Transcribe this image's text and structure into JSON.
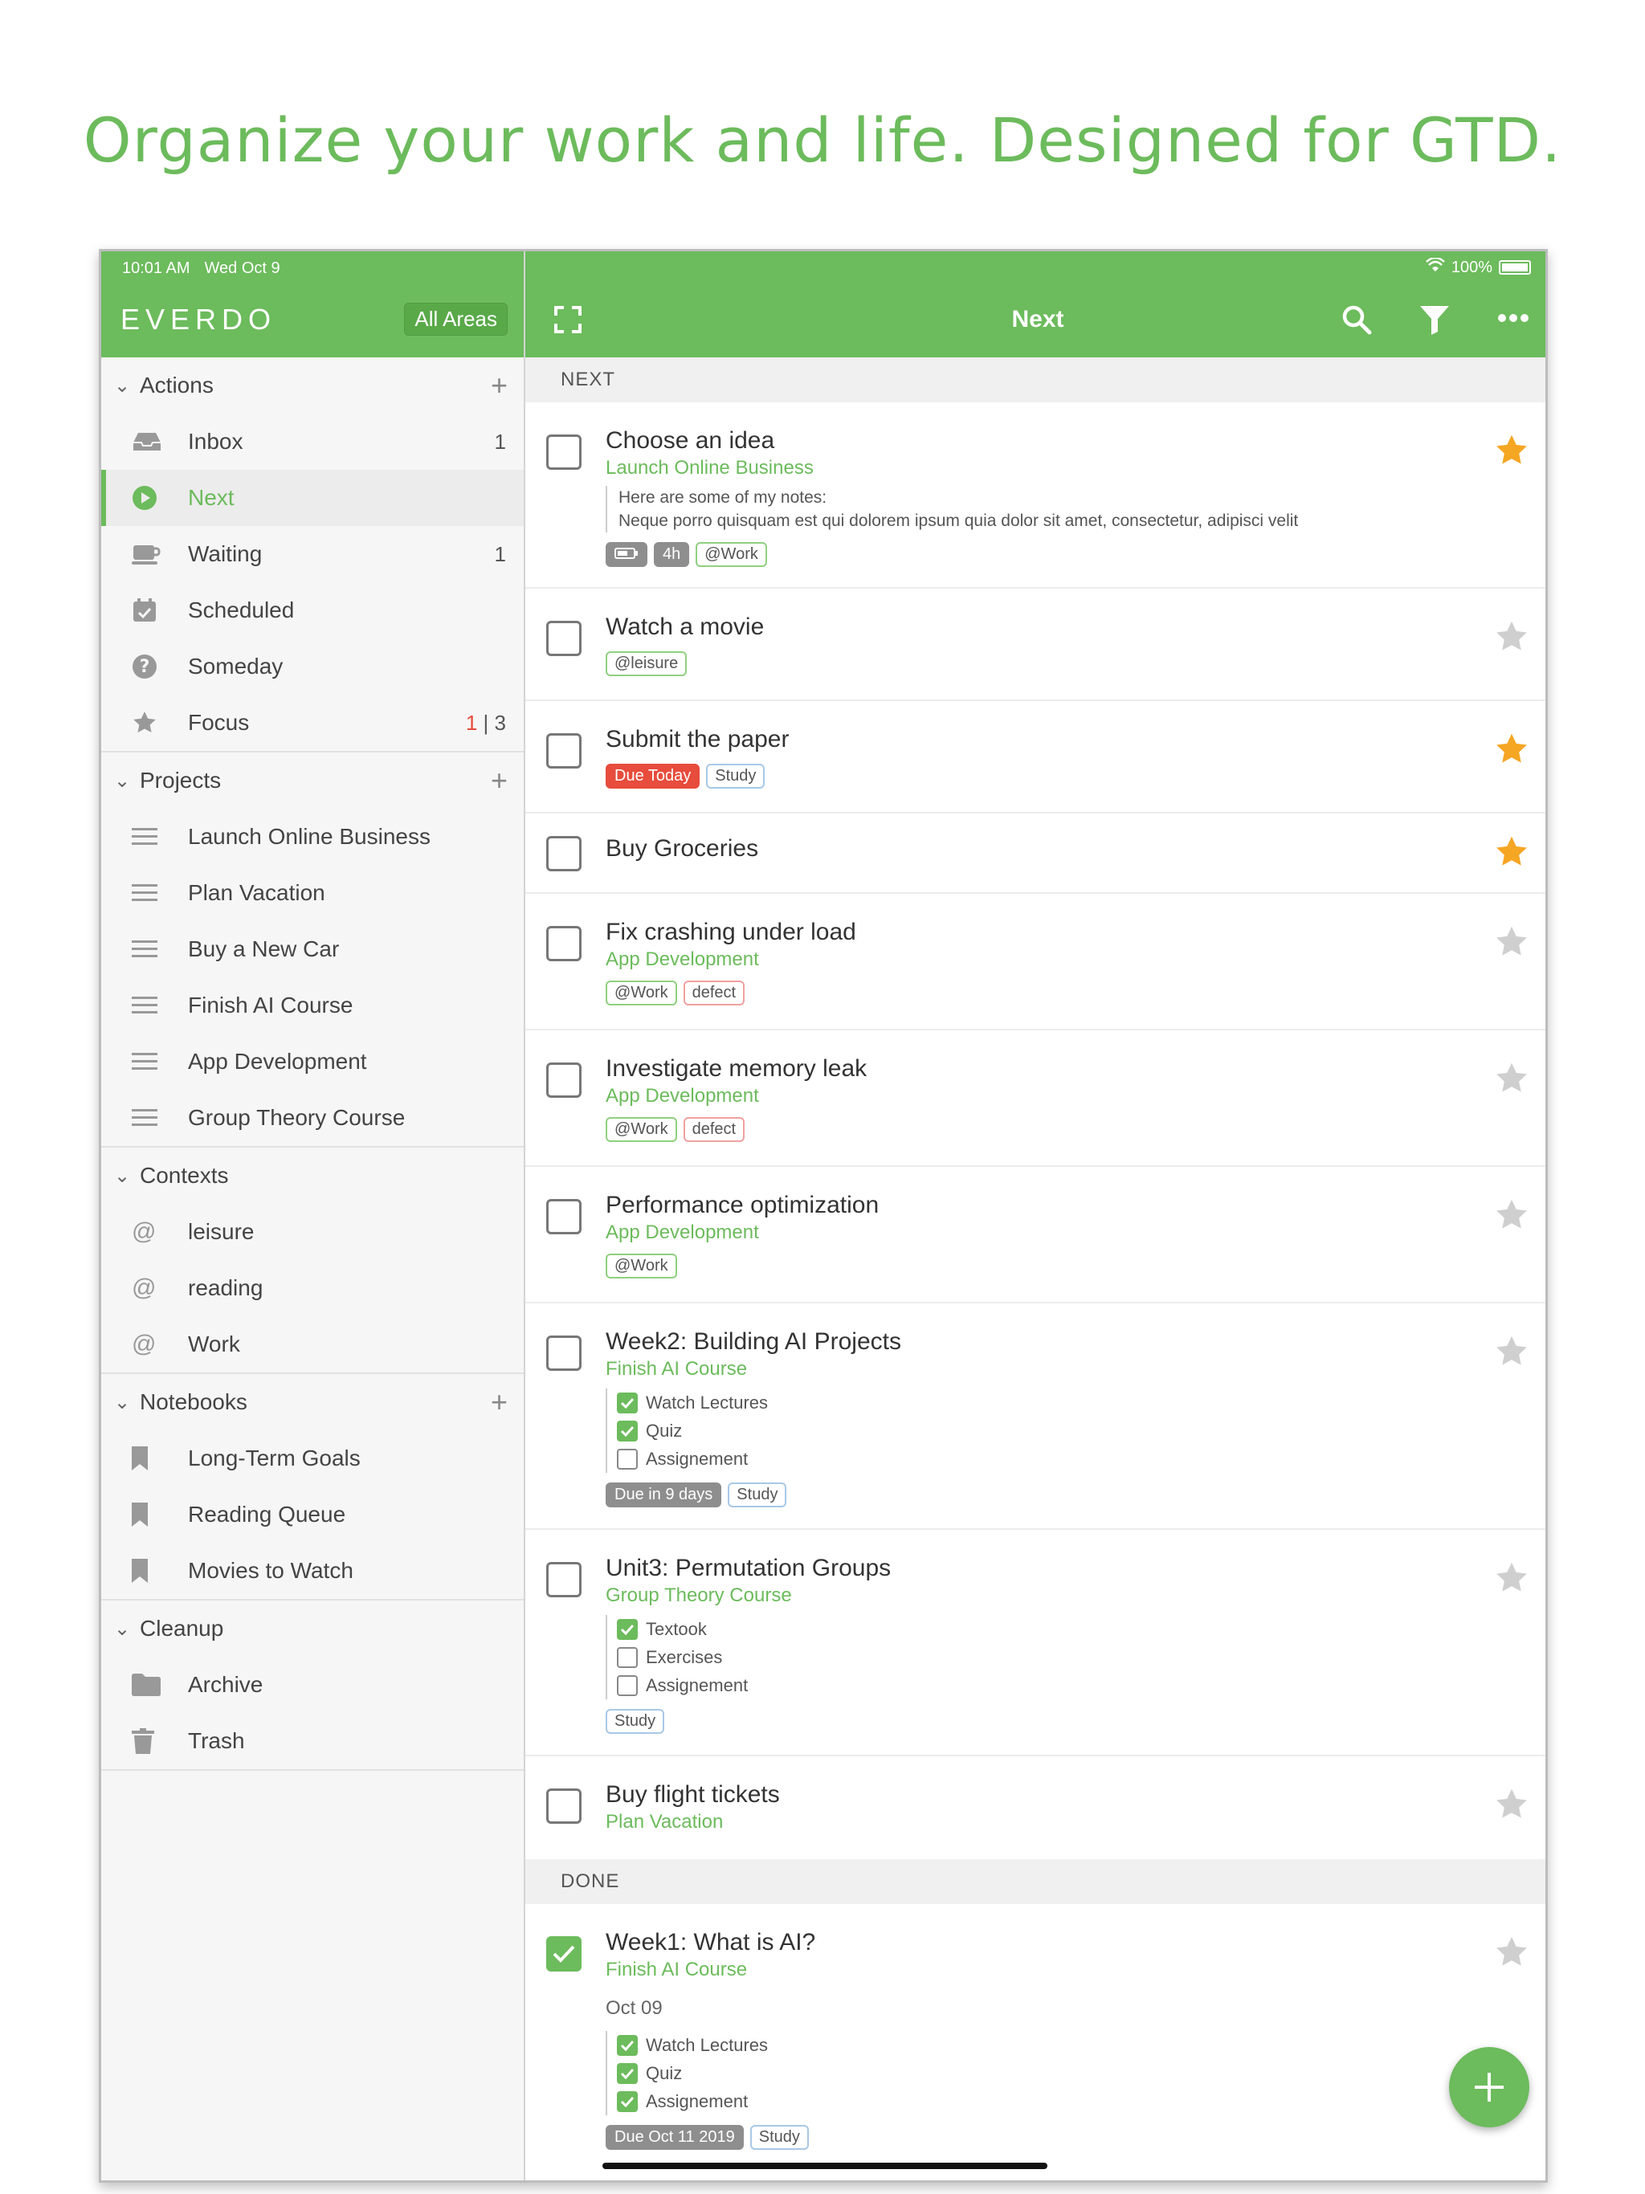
{
  "headline": "Organize your work and life. Designed for GTD.",
  "status": {
    "time": "10:01 AM",
    "date": "Wed Oct 9",
    "battery": "100%"
  },
  "sidebar": {
    "brand": "EVERDO",
    "areas_button": "All Areas",
    "sections": [
      {
        "title": "Actions",
        "items": [
          {
            "label": "Inbox",
            "icon": "inbox-icon",
            "count": "1"
          },
          {
            "label": "Next",
            "icon": "play-circle-icon",
            "count": "",
            "active": true
          },
          {
            "label": "Waiting",
            "icon": "coffee-cup-icon",
            "count": "1"
          },
          {
            "label": "Scheduled",
            "icon": "calendar-check-icon",
            "count": ""
          },
          {
            "label": "Someday",
            "icon": "question-circle-icon",
            "count": ""
          },
          {
            "label": "Focus",
            "icon": "star-icon",
            "count_red": "1",
            "count_sep": "|",
            "count_rest": "3"
          }
        ]
      },
      {
        "title": "Projects",
        "items": [
          {
            "label": "Launch Online Business"
          },
          {
            "label": "Plan Vacation"
          },
          {
            "label": "Buy a New Car"
          },
          {
            "label": "Finish AI Course"
          },
          {
            "label": "App Development"
          },
          {
            "label": "Group Theory Course"
          }
        ]
      },
      {
        "title": "Contexts",
        "items": [
          {
            "label": "leisure"
          },
          {
            "label": "reading"
          },
          {
            "label": "Work"
          }
        ]
      },
      {
        "title": "Notebooks",
        "items": [
          {
            "label": "Long-Term Goals"
          },
          {
            "label": "Reading Queue"
          },
          {
            "label": "Movies to Watch"
          }
        ]
      },
      {
        "title": "Cleanup",
        "items": [
          {
            "label": "Archive"
          },
          {
            "label": "Trash"
          }
        ]
      }
    ]
  },
  "main": {
    "title": "Next",
    "section_next": "NEXT",
    "section_done": "DONE",
    "tasks": [
      {
        "title": "Choose an idea",
        "project": "Launch Online Business",
        "note_1": "Here are some of my notes:",
        "note_2": "Neque porro quisquam est qui dolorem ipsum quia dolor sit amet, consectetur, adipisci velit",
        "tag_time": "4h",
        "tag_ctx": "@Work"
      },
      {
        "title": "Watch a movie",
        "tag_ctx": "@leisure"
      },
      {
        "title": "Submit the paper",
        "tag_due": "Due Today",
        "tag_study": "Study"
      },
      {
        "title": "Buy Groceries"
      },
      {
        "title": "Fix crashing under load",
        "project": "App Development",
        "tag_ctx": "@Work",
        "tag_def": "defect"
      },
      {
        "title": "Investigate memory leak",
        "project": "App Development",
        "tag_ctx": "@Work",
        "tag_def": "defect"
      },
      {
        "title": "Performance optimization",
        "project": "App Development",
        "tag_ctx": "@Work"
      },
      {
        "title": "Week2: Building AI Projects",
        "project": "Finish AI Course",
        "checklist": [
          "Watch Lectures",
          "Quiz",
          "Assignement"
        ],
        "tag_due": "Due in 9 days",
        "tag_study": "Study"
      },
      {
        "title": "Unit3: Permutation Groups",
        "project": "Group Theory Course",
        "checklist": [
          "Textook",
          "Exercises",
          "Assignement"
        ],
        "tag_study": "Study"
      },
      {
        "title": "Buy flight tickets",
        "project": "Plan Vacation"
      },
      {
        "title": "Week1: What is AI?",
        "project": "Finish AI Course",
        "date": "Oct 09",
        "checklist": [
          "Watch Lectures",
          "Quiz",
          "Assignement"
        ],
        "tag_due": "Due Oct 11 2019",
        "tag_study": "Study"
      }
    ]
  },
  "colors": {
    "accent": "#6cbb5c",
    "star_on": "#f5a623",
    "star_off": "#cfcfcf",
    "due_red": "#e74c3c"
  }
}
